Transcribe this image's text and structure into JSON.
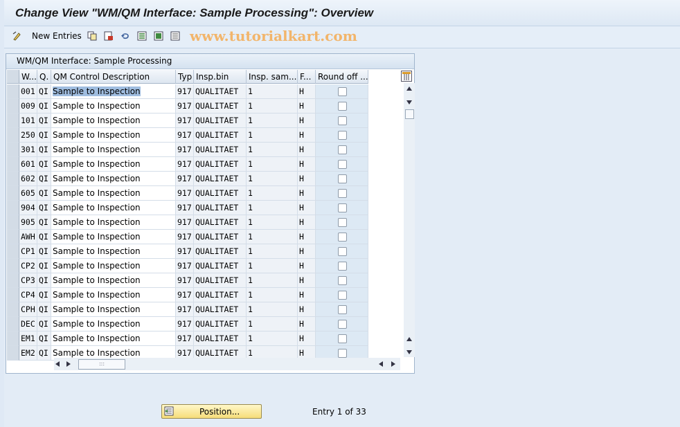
{
  "title": "Change View \"WM/QM Interface: Sample Processing\": Overview",
  "toolbar": {
    "new_entries_label": "New Entries",
    "watermark": "www.tutorialkart.com"
  },
  "panel": {
    "title": "WM/QM Interface: Sample Processing"
  },
  "columns": [
    "W...",
    "Q.",
    "QM Control Description",
    "Typ",
    "Insp.bin",
    "Insp. sam...",
    "F...",
    "Round off ..."
  ],
  "rows": [
    {
      "w": "001",
      "q": "QI",
      "desc": "Sample to Inspection",
      "typ": "917",
      "bin": "QUALITAET",
      "sam": "1",
      "f": "H"
    },
    {
      "w": "009",
      "q": "QI",
      "desc": "Sample to Inspection",
      "typ": "917",
      "bin": "QUALITAET",
      "sam": "1",
      "f": "H"
    },
    {
      "w": "101",
      "q": "QI",
      "desc": "Sample to Inspection",
      "typ": "917",
      "bin": "QUALITAET",
      "sam": "1",
      "f": "H"
    },
    {
      "w": "250",
      "q": "QI",
      "desc": "Sample to Inspection",
      "typ": "917",
      "bin": "QUALITAET",
      "sam": "1",
      "f": "H"
    },
    {
      "w": "301",
      "q": "QI",
      "desc": "Sample to Inspection",
      "typ": "917",
      "bin": "QUALITAET",
      "sam": "1",
      "f": "H"
    },
    {
      "w": "601",
      "q": "QI",
      "desc": "Sample to Inspection",
      "typ": "917",
      "bin": "QUALITAET",
      "sam": "1",
      "f": "H"
    },
    {
      "w": "602",
      "q": "QI",
      "desc": "Sample to Inspection",
      "typ": "917",
      "bin": "QUALITAET",
      "sam": "1",
      "f": "H"
    },
    {
      "w": "605",
      "q": "QI",
      "desc": "Sample to Inspection",
      "typ": "917",
      "bin": "QUALITAET",
      "sam": "1",
      "f": "H"
    },
    {
      "w": "904",
      "q": "QI",
      "desc": "Sample to Inspection",
      "typ": "917",
      "bin": "QUALITAET",
      "sam": "1",
      "f": "H"
    },
    {
      "w": "905",
      "q": "QI",
      "desc": "Sample to Inspection",
      "typ": "917",
      "bin": "QUALITAET",
      "sam": "1",
      "f": "H"
    },
    {
      "w": "AWH",
      "q": "QI",
      "desc": "Sample to Inspection",
      "typ": "917",
      "bin": "QUALITAET",
      "sam": "1",
      "f": "H"
    },
    {
      "w": "CP1",
      "q": "QI",
      "desc": "Sample to Inspection",
      "typ": "917",
      "bin": "QUALITAET",
      "sam": "1",
      "f": "H"
    },
    {
      "w": "CP2",
      "q": "QI",
      "desc": "Sample to Inspection",
      "typ": "917",
      "bin": "QUALITAET",
      "sam": "1",
      "f": "H"
    },
    {
      "w": "CP3",
      "q": "QI",
      "desc": "Sample to Inspection",
      "typ": "917",
      "bin": "QUALITAET",
      "sam": "1",
      "f": "H"
    },
    {
      "w": "CP4",
      "q": "QI",
      "desc": "Sample to Inspection",
      "typ": "917",
      "bin": "QUALITAET",
      "sam": "1",
      "f": "H"
    },
    {
      "w": "CPH",
      "q": "QI",
      "desc": "Sample to Inspection",
      "typ": "917",
      "bin": "QUALITAET",
      "sam": "1",
      "f": "H"
    },
    {
      "w": "DEC",
      "q": "QI",
      "desc": "Sample to Inspection",
      "typ": "917",
      "bin": "QUALITAET",
      "sam": "1",
      "f": "H"
    },
    {
      "w": "EM1",
      "q": "QI",
      "desc": "Sample to Inspection",
      "typ": "917",
      "bin": "QUALITAET",
      "sam": "1",
      "f": "H"
    },
    {
      "w": "EM2",
      "q": "QI",
      "desc": "Sample to Inspection",
      "typ": "917",
      "bin": "QUALITAET",
      "sam": "1",
      "f": "H"
    }
  ],
  "footer": {
    "position_label": "Position...",
    "entry_text": "Entry 1 of 33"
  },
  "icons": [
    "toggle-display-change-icon",
    "copy-icon",
    "delete-icon",
    "undo-icon",
    "select-all-icon",
    "select-block-icon",
    "deselect-all-icon",
    "column-settings-icon",
    "position-icon"
  ]
}
